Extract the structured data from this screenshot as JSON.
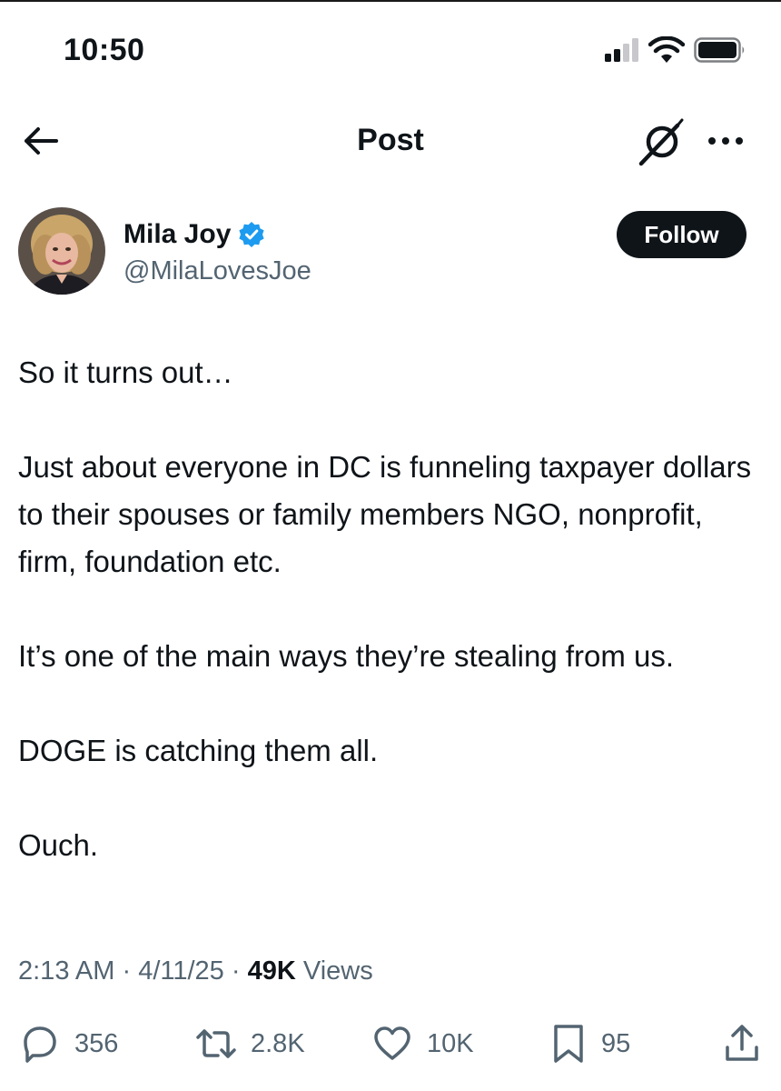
{
  "status_bar": {
    "time": "10:50"
  },
  "nav": {
    "title": "Post",
    "icons": [
      "back-arrow-icon",
      "grok-icon",
      "more-options-icon"
    ]
  },
  "author": {
    "name": "Mila Joy",
    "handle": "@MilaLovesJoe",
    "verified": true,
    "follow_label": "Follow"
  },
  "post": {
    "paragraphs": [
      "So it turns out…",
      "Just about everyone in DC is funneling taxpayer dollars to their spouses or family members NGO, nonprofit, firm, foundation etc.",
      "It’s one of the main ways they’re stealing from us.",
      "DOGE is catching them all.",
      "Ouch."
    ],
    "time": "2:13 AM",
    "separator": "·",
    "date": "4/11/25",
    "views_count": "49K",
    "views_label": "Views"
  },
  "actions": {
    "replies": "356",
    "reposts": "2.8K",
    "likes": "10K",
    "bookmarks": "95"
  },
  "colors": {
    "text": "#0f1419",
    "secondary": "#536471",
    "verified": "#1d9bf0",
    "follow_bg": "#0f1419"
  }
}
